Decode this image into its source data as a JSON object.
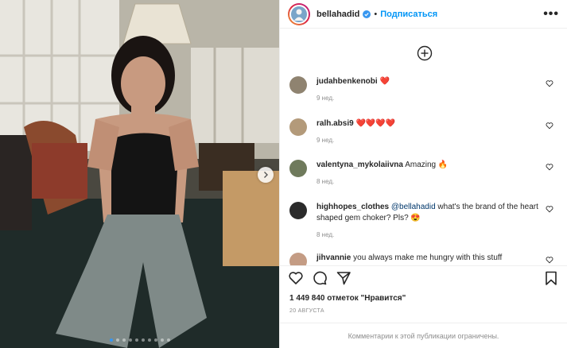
{
  "owner": {
    "username": "bellahadid",
    "separator": "•",
    "follow_label": "Подписаться",
    "more_label": "•••"
  },
  "comments": [
    {
      "username": "judahbenkenobi",
      "text": "❤️",
      "time": "9 нед."
    },
    {
      "username": "ralh.absi9",
      "text": "❤️❤️❤️❤️",
      "time": "9 нед."
    },
    {
      "username": "valentyna_mykolaiivna",
      "text": "Amazing 🔥",
      "time": "8 нед."
    },
    {
      "username": "highhopes_clothes",
      "mention": "@bellahadid",
      "text": " what's the brand of the heart shaped gem choker? Pls? 😍",
      "time": "8 нед."
    },
    {
      "username": "jihvannie",
      "text": "you always make me hungry with this stuff",
      "time": ""
    }
  ],
  "likes": "1 449 840 отметок \"Нравится\"",
  "date": "20 АВГУСТА",
  "footer_text": "Комментарии к этой публикации ограничены.",
  "carousel": {
    "total": 10,
    "active_index": 0
  },
  "colors": {
    "accent": "#0095f6",
    "heart": "#ed4956",
    "active_dot": "#3897f0"
  },
  "icons": [
    "verified-icon",
    "plus-circle-icon",
    "heart-icon",
    "comment-icon",
    "share-icon",
    "bookmark-icon",
    "chevron-right-icon"
  ]
}
